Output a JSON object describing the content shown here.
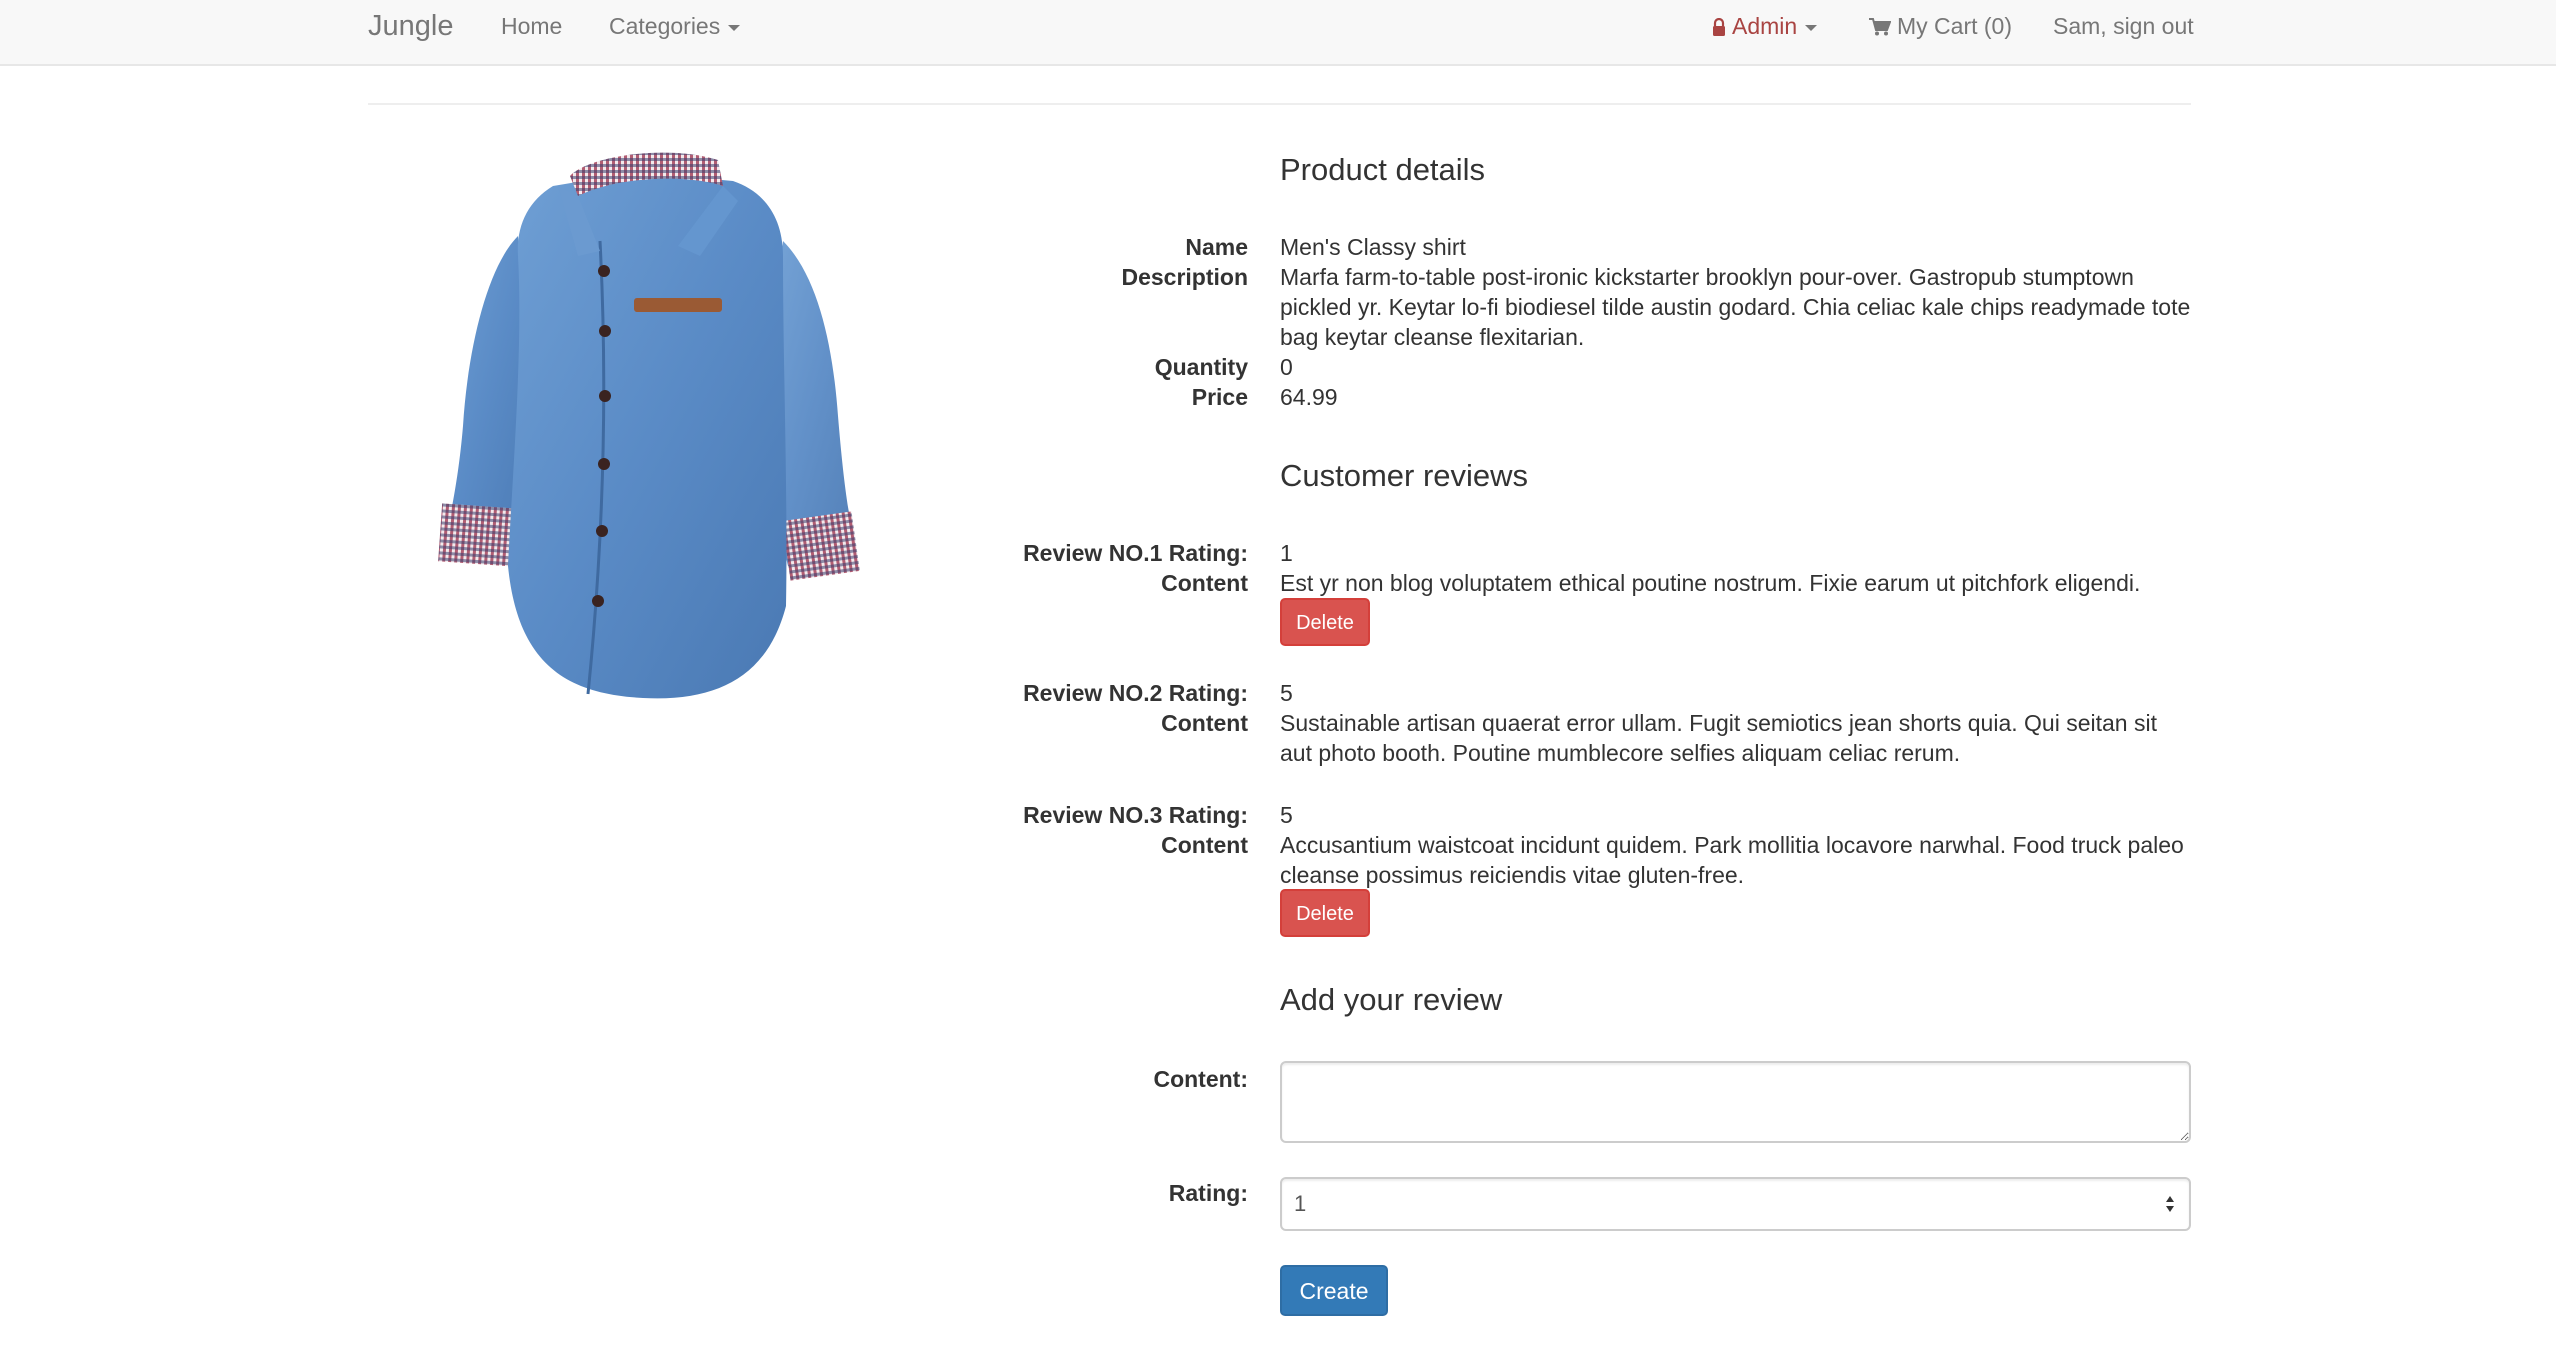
{
  "navbar": {
    "brand": "Jungle",
    "home": "Home",
    "categories": "Categories",
    "admin": "Admin",
    "cart": "My Cart (0)",
    "user": "Sam, sign out"
  },
  "product": {
    "image_alt": "Men's blue denim shirt",
    "details_heading": "Product details",
    "labels": {
      "name": "Name",
      "description": "Description",
      "quantity": "Quantity",
      "price": "Price"
    },
    "name": "Men's Classy shirt",
    "description": "Marfa farm-to-table post-ironic kickstarter brooklyn pour-over. Gastropub stumptown pickled yr. Keytar lo-fi biodiesel tilde austin godard. Chia celiac kale chips readymade tote bag keytar cleanse flexitarian.",
    "quantity": "0",
    "price": "64.99"
  },
  "reviews": {
    "heading": "Customer reviews",
    "content_label": "Content",
    "delete_label": "Delete",
    "items": [
      {
        "rating_label": "Review NO.1 Rating:",
        "rating": "1",
        "content": "Est yr non blog voluptatem ethical poutine nostrum. Fixie earum ut pitchfork eligendi."
      },
      {
        "rating_label": "Review NO.2 Rating:",
        "rating": "5",
        "content": "Sustainable artisan quaerat error ullam. Fugit semiotics jean shorts quia. Qui seitan sit aut photo booth. Poutine mumblecore selfies aliquam celiac rerum."
      },
      {
        "rating_label": "Review NO.3 Rating:",
        "rating": "5",
        "content": "Accusantium waistcoat incidunt quidem. Park mollitia locavore narwhal. Food truck paleo cleanse possimus reiciendis vitae gluten-free."
      }
    ]
  },
  "review_form": {
    "heading": "Add your review",
    "content_label": "Content:",
    "rating_label": "Rating:",
    "rating_value": "1",
    "submit_label": "Create"
  },
  "colors": {
    "navbar_bg": "#f8f8f8",
    "admin": "#a94442",
    "danger": "#d9534f",
    "primary": "#337ab7"
  }
}
